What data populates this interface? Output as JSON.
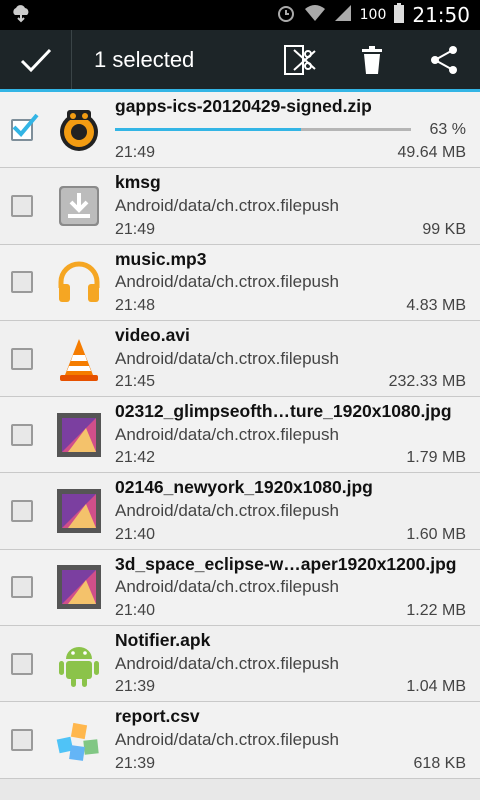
{
  "status": {
    "time": "21:50",
    "battery": "100"
  },
  "action_bar": {
    "title": "1 selected"
  },
  "files": [
    {
      "name": "gapps-ics-20120429-signed.zip",
      "path": "",
      "time": "21:49",
      "size": "49.64 MB",
      "progress_percent": 63,
      "progress_text": "63 %",
      "checked": true,
      "icon": "clockworkmod-icon"
    },
    {
      "name": "kmsg",
      "path": "Android/data/ch.ctrox.filepush",
      "time": "21:49",
      "size": "99 KB",
      "checked": false,
      "icon": "download-icon"
    },
    {
      "name": "music.mp3",
      "path": "Android/data/ch.ctrox.filepush",
      "time": "21:48",
      "size": "4.83 MB",
      "checked": false,
      "icon": "headphones-icon"
    },
    {
      "name": "video.avi",
      "path": "Android/data/ch.ctrox.filepush",
      "time": "21:45",
      "size": "232.33 MB",
      "checked": false,
      "icon": "vlc-cone-icon"
    },
    {
      "name": "02312_glimpseofth…ture_1920x1080.jpg",
      "path": "Android/data/ch.ctrox.filepush",
      "time": "21:42",
      "size": "1.79 MB",
      "checked": false,
      "icon": "picture-icon"
    },
    {
      "name": "02146_newyork_1920x1080.jpg",
      "path": "Android/data/ch.ctrox.filepush",
      "time": "21:40",
      "size": "1.60 MB",
      "checked": false,
      "icon": "picture-icon"
    },
    {
      "name": "3d_space_eclipse-w…aper1920x1200.jpg",
      "path": "Android/data/ch.ctrox.filepush",
      "time": "21:40",
      "size": "1.22 MB",
      "checked": false,
      "icon": "picture-icon"
    },
    {
      "name": "Notifier.apk",
      "path": "Android/data/ch.ctrox.filepush",
      "time": "21:39",
      "size": "1.04 MB",
      "checked": false,
      "icon": "android-icon"
    },
    {
      "name": "report.csv",
      "path": "Android/data/ch.ctrox.filepush",
      "time": "21:39",
      "size": "618 KB",
      "checked": false,
      "icon": "spreadsheet-icon"
    }
  ],
  "colors": {
    "accent": "#33b5e5",
    "action_bar": "#1d2528"
  }
}
